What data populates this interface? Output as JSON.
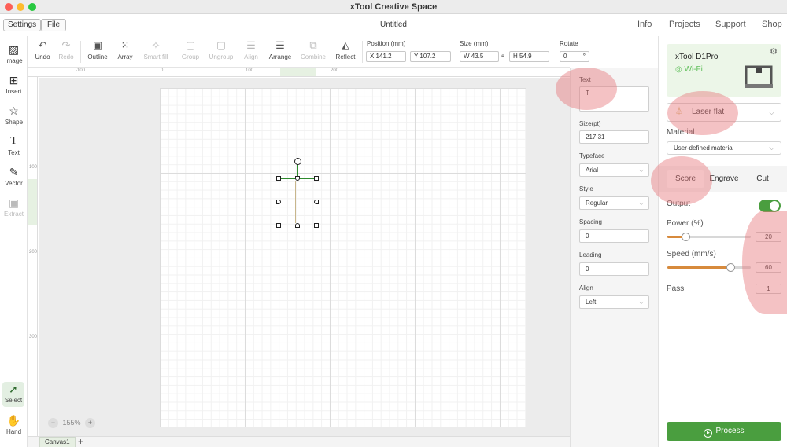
{
  "app": {
    "title": "xTool Creative Space",
    "document_title": "Untitled"
  },
  "menubar": {
    "settings": "Settings",
    "file": "File",
    "nav": [
      "Info",
      "Projects",
      "Support",
      "Shop"
    ]
  },
  "left_tools": [
    {
      "label": "Image",
      "icon": "image-icon",
      "glyph": "▨"
    },
    {
      "label": "Insert",
      "icon": "insert-icon",
      "glyph": "⊞"
    },
    {
      "label": "Shape",
      "icon": "shape-icon",
      "glyph": "☆"
    },
    {
      "label": "Text",
      "icon": "text-icon",
      "glyph": "T"
    },
    {
      "label": "Vector",
      "icon": "vector-icon",
      "glyph": "✎"
    },
    {
      "label": "Extract",
      "icon": "extract-icon",
      "glyph": "▣"
    },
    {
      "label": "Select",
      "icon": "cursor-icon",
      "glyph": "➚"
    },
    {
      "label": "Hand",
      "icon": "hand-icon",
      "glyph": "✋"
    }
  ],
  "toolbar": {
    "items": [
      {
        "label": "Undo",
        "icon": "undo-icon",
        "glyph": "↶"
      },
      {
        "label": "Redo",
        "icon": "redo-icon",
        "glyph": "↷"
      },
      {
        "label": "Outline",
        "icon": "outline-icon",
        "glyph": "▣"
      },
      {
        "label": "Array",
        "icon": "array-icon",
        "glyph": "⁙"
      },
      {
        "label": "Smart fill",
        "icon": "smart-fill-icon",
        "glyph": "✧"
      },
      {
        "label": "Group",
        "icon": "group-icon",
        "glyph": "▢"
      },
      {
        "label": "Ungroup",
        "icon": "ungroup-icon",
        "glyph": "▢"
      },
      {
        "label": "Align",
        "icon": "align-icon",
        "glyph": "☰"
      },
      {
        "label": "Arrange",
        "icon": "arrange-icon",
        "glyph": "☰"
      },
      {
        "label": "Combine",
        "icon": "combine-icon",
        "glyph": "⧉"
      },
      {
        "label": "Reflect",
        "icon": "reflect-icon",
        "glyph": "◭"
      }
    ],
    "position_label": "Position (mm)",
    "size_label": "Size (mm)",
    "rotate_label": "Rotate",
    "x": "X  141.2",
    "y": "Y  107.2",
    "w": "W  43.5",
    "h": "H  54.9",
    "rotate": "0",
    "rotate_unit": "°"
  },
  "ruler": {
    "h_ticks": [
      "-100",
      "0",
      "100",
      "200"
    ],
    "v_ticks": [
      "100",
      "200",
      "300"
    ]
  },
  "canvas": {
    "zoom": "155%",
    "tab": "Canvas1",
    "add": "+"
  },
  "text_panel": {
    "text_label": "Text",
    "text_value": "T",
    "size_label": "Size(pt)",
    "size_value": "217.31",
    "typeface_label": "Typeface",
    "typeface_value": "Arial",
    "style_label": "Style",
    "style_value": "Regular",
    "spacing_label": "Spacing",
    "spacing_value": "0",
    "leading_label": "Leading",
    "leading_value": "0",
    "align_label": "Align",
    "align_value": "Left"
  },
  "device": {
    "name": "xTool D1Pro",
    "connection": "Wi-Fi"
  },
  "laser": {
    "mode": "Laser flat",
    "material_label": "Material",
    "material_value": "User-defined material",
    "tabs": [
      "Score",
      "Engrave",
      "Cut"
    ],
    "active_tab": "Score",
    "output_label": "Output",
    "power_label": "Power (%)",
    "power_value": "20",
    "power_fraction": 0.22,
    "speed_label": "Speed (mm/s)",
    "speed_value": "60",
    "speed_fraction": 0.75,
    "pass_label": "Pass",
    "pass_value": "1",
    "process": "Process"
  },
  "colors": {
    "accent": "#4a9e3f",
    "highlight": "#e6787d"
  }
}
